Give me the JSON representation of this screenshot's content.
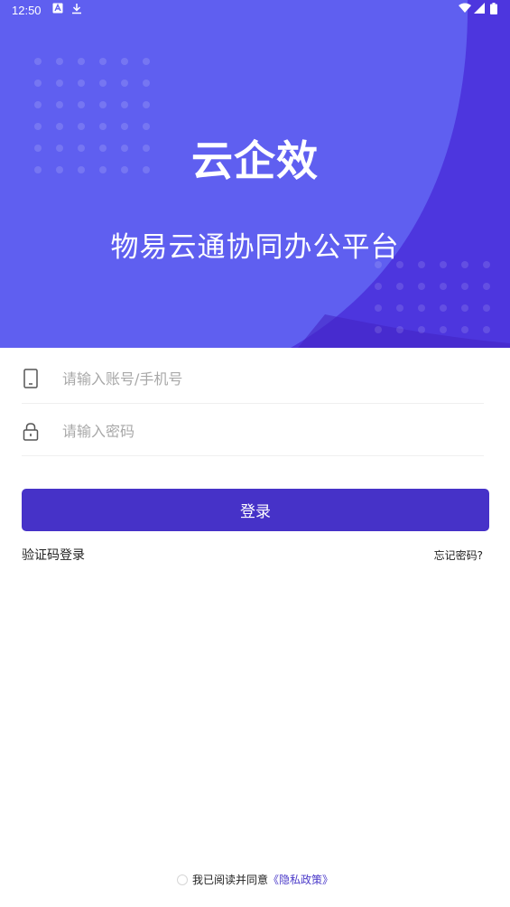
{
  "status_bar": {
    "time": "12:50",
    "icons": [
      "a-notification-icon",
      "download-icon",
      "wifi-icon",
      "signal-icon",
      "battery-icon"
    ]
  },
  "hero": {
    "title": "云企效",
    "subtitle": "物易云通协同办公平台"
  },
  "form": {
    "account": {
      "icon": "phone-icon",
      "placeholder": "请输入账号/手机号",
      "value": ""
    },
    "password": {
      "icon": "lock-icon",
      "placeholder": "请输入密码",
      "value": ""
    }
  },
  "login_button": "登录",
  "links": {
    "sms_login": "验证码登录",
    "forgot_password": "忘记密码?"
  },
  "agreement": {
    "text": "我已阅读并同意",
    "policy": "《隐私政策》",
    "checked": false
  },
  "colors": {
    "hero": "#5f5ff0",
    "hero_dark": "#4d36de",
    "primary_button": "#4632c8",
    "link": "#4b3ac9"
  }
}
